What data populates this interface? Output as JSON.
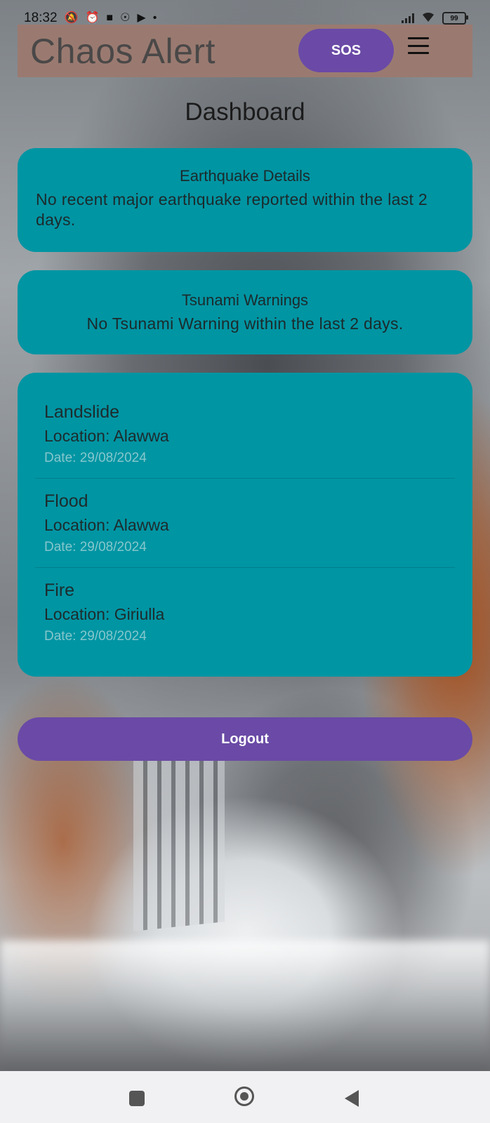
{
  "status_bar": {
    "time": "18:32",
    "battery": "99",
    "dot": "•"
  },
  "app_bar": {
    "title": "Chaos Alert",
    "sos_label": "SOS"
  },
  "page": {
    "title": "Dashboard"
  },
  "earthquake": {
    "heading": "Earthquake Details",
    "text": "No recent major earthquake reported within the last 2 days."
  },
  "tsunami": {
    "heading": "Tsunami Warnings",
    "text": "No Tsunami Warning within the last 2 days."
  },
  "incidents": [
    {
      "type": "Landslide",
      "location": "Location: Alawwa",
      "date": "Date: 29/08/2024"
    },
    {
      "type": "Flood",
      "location": "Location: Alawwa",
      "date": "Date: 29/08/2024"
    },
    {
      "type": "Fire",
      "location": "Location: Giriulla",
      "date": "Date: 29/08/2024"
    }
  ],
  "logout_label": "Logout",
  "colors": {
    "app_bar": "#9a7a70",
    "primary_button": "#6a4aa6",
    "card": "#0095a3"
  },
  "icons": {
    "status_left": [
      "mute-notifications-icon",
      "alarm-icon",
      "square-notification-icon",
      "location-icon",
      "game-controller-icon"
    ],
    "status_right": [
      "signal-icon",
      "wifi-icon",
      "battery-icon"
    ],
    "menu": "hamburger-menu-icon",
    "nav": [
      "recent-apps-icon",
      "home-icon",
      "back-icon"
    ]
  }
}
